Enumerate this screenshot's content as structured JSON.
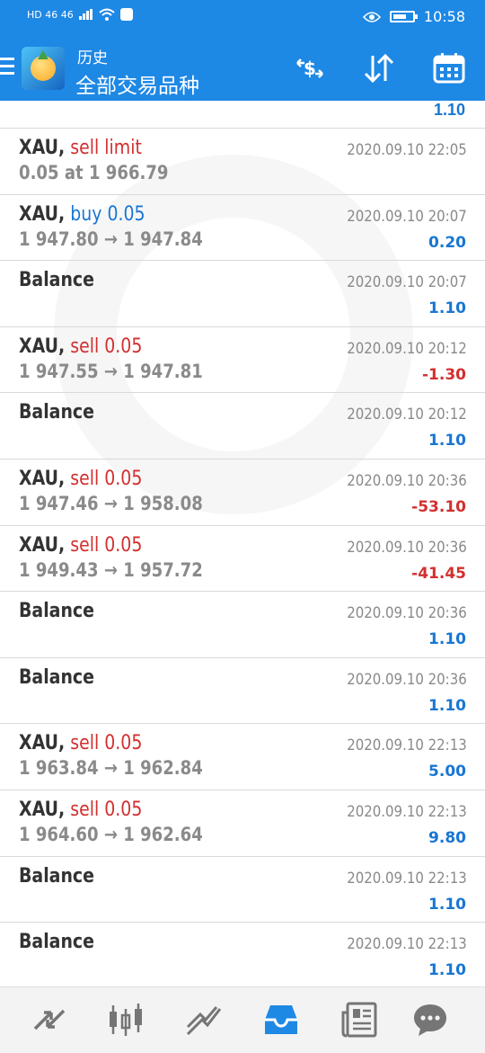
{
  "status_bar": {
    "left_text": "HD 46 46",
    "time": "10:58"
  },
  "header": {
    "subtitle": "历史",
    "title": "全部交易品种"
  },
  "top_partial_value": "1.10",
  "rows": [
    {
      "symbol": "XAU,",
      "action": "sell limit",
      "action_type": "sell",
      "detail": "0.05 at 1 966.79",
      "time": "2020.09.10 22:05",
      "amount": "",
      "amount_type": ""
    },
    {
      "symbol": "XAU,",
      "action": "buy 0.05",
      "action_type": "buy",
      "detail": "1 947.80 → 1 947.84",
      "time": "2020.09.10 20:07",
      "amount": "0.20",
      "amount_type": "pos"
    },
    {
      "symbol": "Balance",
      "action": "",
      "action_type": "",
      "detail": "",
      "time": "2020.09.10 20:07",
      "amount": "1.10",
      "amount_type": "pos"
    },
    {
      "symbol": "XAU,",
      "action": "sell 0.05",
      "action_type": "sell",
      "detail": "1 947.55 → 1 947.81",
      "time": "2020.09.10 20:12",
      "amount": "-1.30",
      "amount_type": "neg"
    },
    {
      "symbol": "Balance",
      "action": "",
      "action_type": "",
      "detail": "",
      "time": "2020.09.10 20:12",
      "amount": "1.10",
      "amount_type": "pos"
    },
    {
      "symbol": "XAU,",
      "action": "sell 0.05",
      "action_type": "sell",
      "detail": "1 947.46 → 1 958.08",
      "time": "2020.09.10 20:36",
      "amount": "-53.10",
      "amount_type": "neg"
    },
    {
      "symbol": "XAU,",
      "action": "sell 0.05",
      "action_type": "sell",
      "detail": "1 949.43 → 1 957.72",
      "time": "2020.09.10 20:36",
      "amount": "-41.45",
      "amount_type": "neg"
    },
    {
      "symbol": "Balance",
      "action": "",
      "action_type": "",
      "detail": "",
      "time": "2020.09.10 20:36",
      "amount": "1.10",
      "amount_type": "pos"
    },
    {
      "symbol": "Balance",
      "action": "",
      "action_type": "",
      "detail": "",
      "time": "2020.09.10 20:36",
      "amount": "1.10",
      "amount_type": "pos"
    },
    {
      "symbol": "XAU,",
      "action": "sell 0.05",
      "action_type": "sell",
      "detail": "1 963.84 → 1 962.84",
      "time": "2020.09.10 22:13",
      "amount": "5.00",
      "amount_type": "pos"
    },
    {
      "symbol": "XAU,",
      "action": "sell 0.05",
      "action_type": "sell",
      "detail": "1 964.60 → 1 962.64",
      "time": "2020.09.10 22:13",
      "amount": "9.80",
      "amount_type": "pos"
    },
    {
      "symbol": "Balance",
      "action": "",
      "action_type": "",
      "detail": "",
      "time": "2020.09.10 22:13",
      "amount": "1.10",
      "amount_type": "pos"
    },
    {
      "symbol": "Balance",
      "action": "",
      "action_type": "",
      "detail": "",
      "time": "2020.09.10 22:13",
      "amount": "1.10",
      "amount_type": "pos"
    }
  ],
  "colors": {
    "primary": "#1e88e5",
    "sell": "#d32f2f",
    "buy": "#1976d2",
    "muted": "#8a8a8a"
  },
  "tabs": [
    {
      "icon": "quotes-icon"
    },
    {
      "icon": "chart-icon"
    },
    {
      "icon": "trade-icon"
    },
    {
      "icon": "history-icon",
      "active": true
    },
    {
      "icon": "news-icon"
    },
    {
      "icon": "chat-icon"
    }
  ]
}
